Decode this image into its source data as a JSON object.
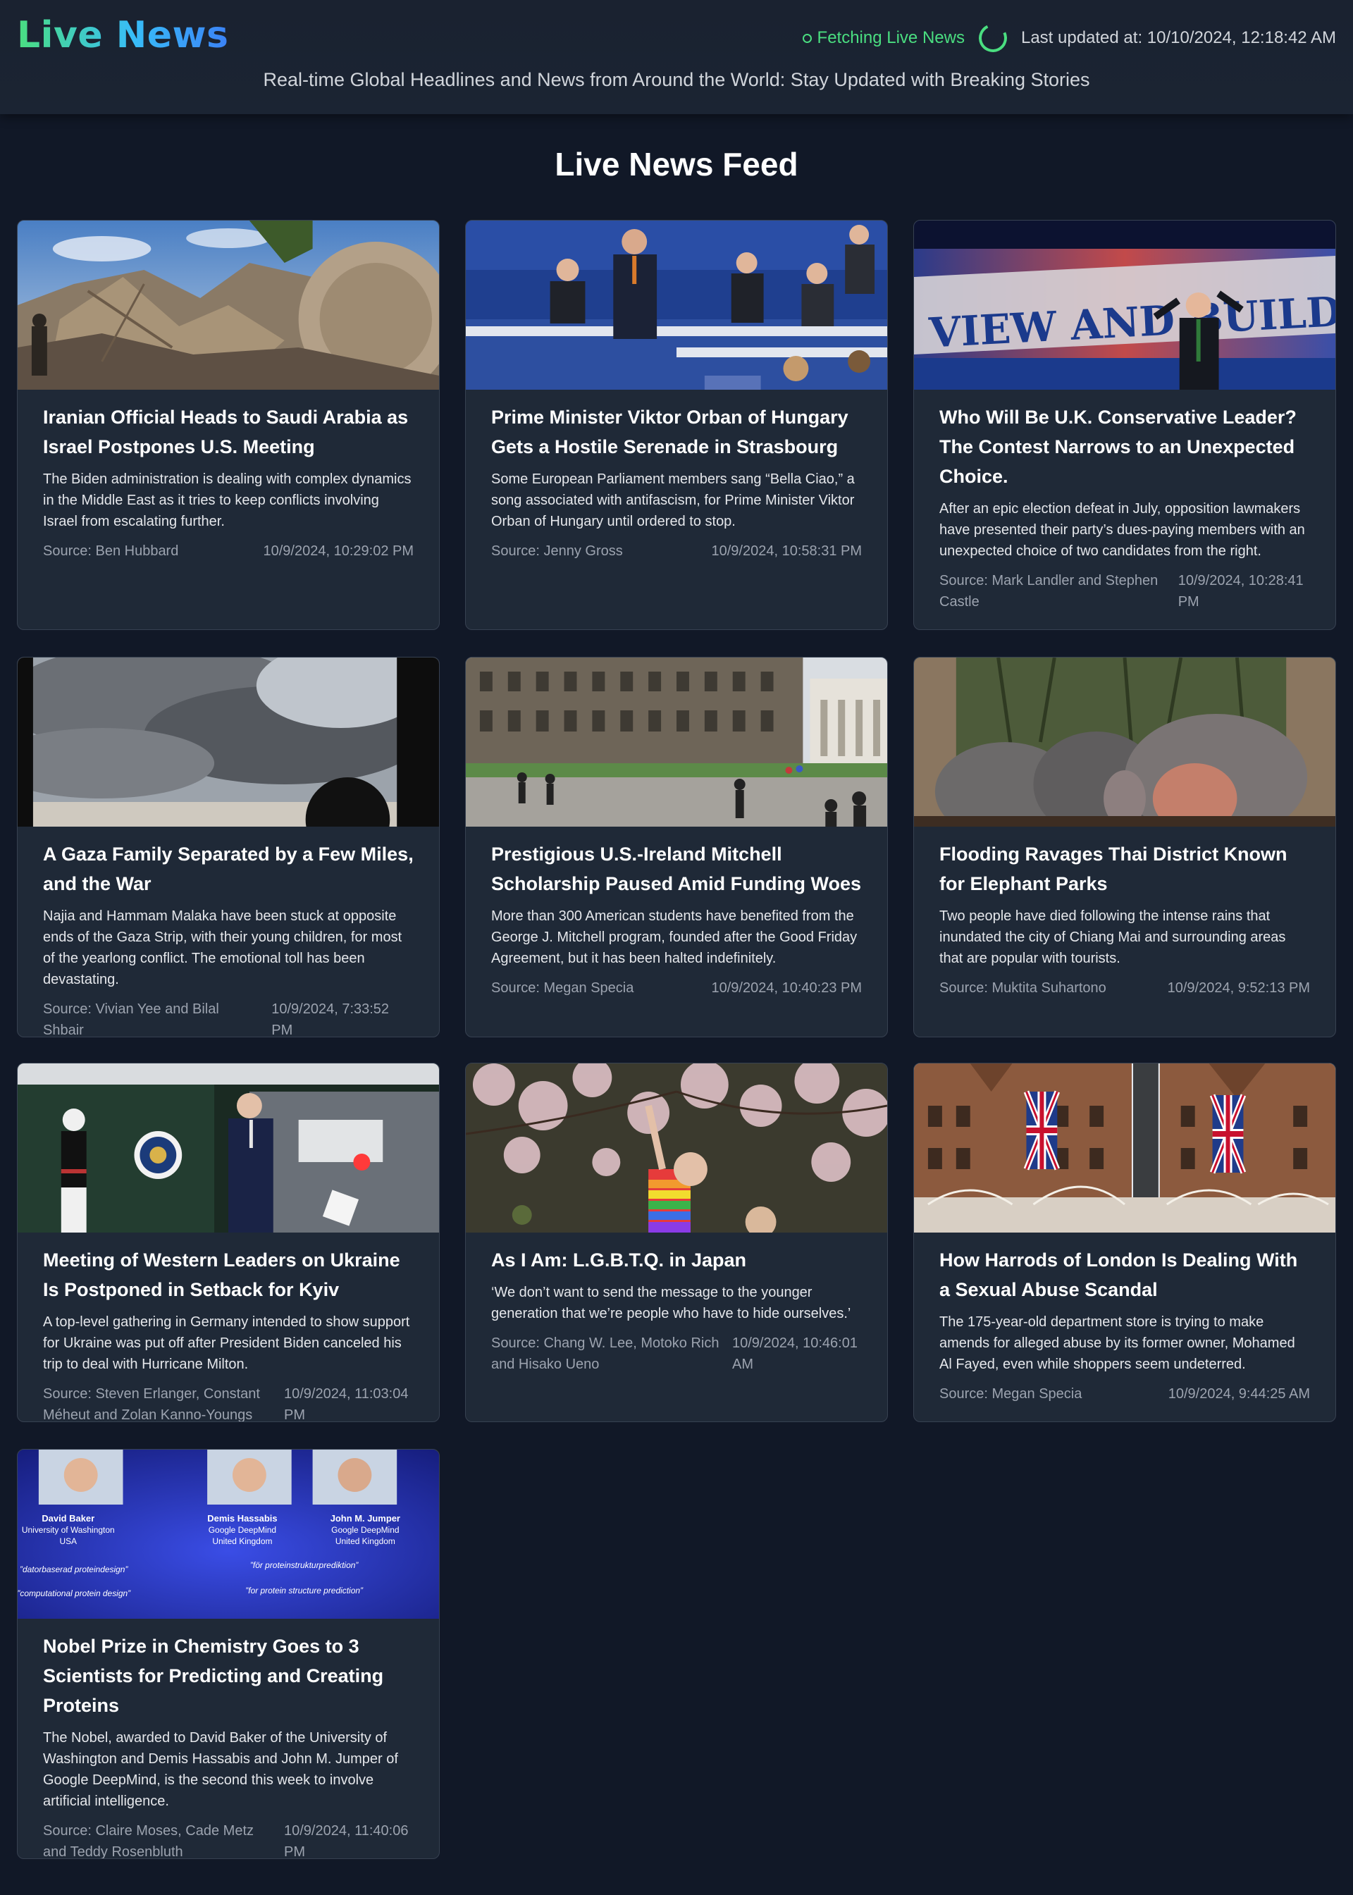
{
  "header": {
    "logo": "Live News",
    "status": "Fetching Live News",
    "last_updated": "Last updated at: 10/10/2024, 12:18:42 AM",
    "subtitle": "Real-time Global Headlines and News from Around the World: Stay Updated with Breaking Stories"
  },
  "feed": {
    "title": "Live News Feed"
  },
  "colors": {
    "accent": "#4ade80",
    "background": "#111827",
    "card": "#1f2937"
  },
  "articles": [
    {
      "title": "Iranian Official Heads to Saudi Arabia as Israel Postpones U.S. Meeting",
      "description": "The Biden administration is dealing with complex dynamics in the Middle East as it tries to keep conflicts involving Israel from escalating further.",
      "source": "Source: Ben Hubbard",
      "date": "10/9/2024, 10:29:02 PM"
    },
    {
      "title": "Prime Minister Viktor Orban of Hungary Gets a Hostile Serenade in Strasbourg",
      "description": "Some European Parliament members sang “Bella Ciao,” a song associated with antifascism, for Prime Minister Viktor Orban of Hungary until ordered to stop.",
      "source": "Source: Jenny Gross",
      "date": "10/9/2024, 10:58:31 PM"
    },
    {
      "title": "Who Will Be U.K. Conservative Leader? The Contest Narrows to an Unexpected Choice.",
      "description": "After an epic election defeat in July, opposition lawmakers have presented their party’s dues-paying members with an unexpected choice of two candidates from the right.",
      "source": "Source: Mark Landler and Stephen Castle",
      "date": "10/9/2024, 10:28:41 PM"
    },
    {
      "title": "A Gaza Family Separated by a Few Miles, and the War",
      "description": "Najia and Hammam Malaka have been stuck at opposite ends of the Gaza Strip, with their young children, for most of the yearlong conflict. The emotional toll has been devastating.",
      "source": "Source: Vivian Yee and Bilal Shbair",
      "date": "10/9/2024, 7:33:52 PM"
    },
    {
      "title": "Prestigious U.S.-Ireland Mitchell Scholarship Paused Amid Funding Woes",
      "description": "More than 300 American students have benefited from the George J. Mitchell program, founded after the Good Friday Agreement, but it has been halted indefinitely.",
      "source": "Source: Megan Specia",
      "date": "10/9/2024, 10:40:23 PM"
    },
    {
      "title": "Flooding Ravages Thai District Known for Elephant Parks",
      "description": "Two people have died following the intense rains that inundated the city of Chiang Mai and surrounding areas that are popular with tourists.",
      "source": "Source: Muktita Suhartono",
      "date": "10/9/2024, 9:52:13 PM"
    },
    {
      "title": "Meeting of Western Leaders on Ukraine Is Postponed in Setback for Kyiv",
      "description": "A top-level gathering in Germany intended to show support for Ukraine was put off after President Biden canceled his trip to deal with Hurricane Milton.",
      "source": "Source: Steven Erlanger, Constant Méheut and Zolan Kanno-Youngs",
      "date": "10/9/2024, 11:03:04 PM"
    },
    {
      "title": "As I Am: L.G.B.T.Q. in Japan",
      "description": "‘We don’t want to send the message to the younger generation that we’re people who have to hide ourselves.’",
      "source": "Source: Chang W. Lee, Motoko Rich and Hisako Ueno",
      "date": "10/9/2024, 10:46:01 AM"
    },
    {
      "title": "How Harrods of London Is Dealing With a Sexual Abuse Scandal",
      "description": "The 175-year-old department store is trying to make amends for alleged abuse by its former owner, Mohamed Al Fayed, even while shoppers seem undeterred.",
      "source": "Source: Megan Specia",
      "date": "10/9/2024, 9:44:25 AM"
    },
    {
      "title": "Nobel Prize in Chemistry Goes to 3 Scientists for Predicting and Creating Proteins",
      "description": "The Nobel, awarded to David Baker of the University of Washington and Demis Hassabis and John M. Jumper of Google DeepMind, is the second this week to involve artificial intelligence.",
      "source": "Source: Claire Moses, Cade Metz and Teddy Rosenbluth",
      "date": "10/9/2024, 11:40:06 PM"
    }
  ],
  "images": {
    "conservative": {
      "sign_text": "VIEW AND BUILD"
    },
    "nobel": {
      "laureates": [
        {
          "name": "David Baker",
          "line1": "University of Washington",
          "line2": "USA"
        },
        {
          "name": "Demis Hassabis",
          "line1": "Google DeepMind",
          "line2": "United Kingdom"
        },
        {
          "name": "John M. Jumper",
          "line1": "Google DeepMind",
          "line2": "United Kingdom"
        }
      ],
      "citations": [
        "”datorbaserad proteindesign”",
        "”för proteinstrukturprediktion”",
        "”computational protein design”",
        "”for protein structure prediction”"
      ]
    }
  }
}
